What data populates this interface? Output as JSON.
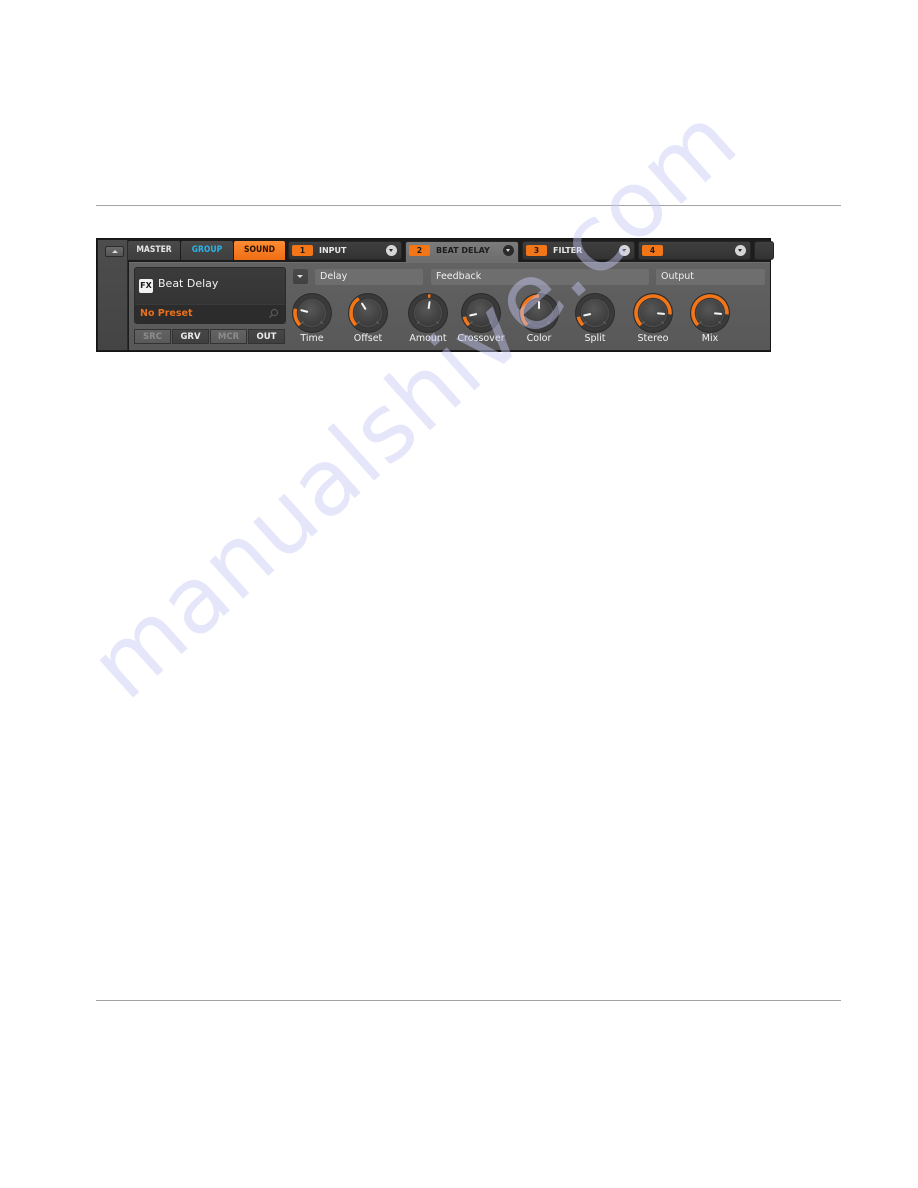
{
  "panel": {
    "collapse_icon": "triangle-up-icon",
    "tabs": [
      {
        "label": "MASTER",
        "state": "normal"
      },
      {
        "label": "GROUP",
        "state": "normal",
        "color": "#2bb3e6"
      },
      {
        "label": "SOUND",
        "state": "active",
        "color": "#f27518"
      }
    ],
    "slots": [
      {
        "number": "1",
        "name": "INPUT",
        "selected": false
      },
      {
        "number": "2",
        "name": "BEAT DELAY",
        "selected": true
      },
      {
        "number": "3",
        "name": "FILTER",
        "selected": false
      },
      {
        "number": "4",
        "name": "",
        "selected": false
      }
    ]
  },
  "preset": {
    "badge": "FX",
    "plugin_name": "Beat Delay",
    "preset_name": "No Preset",
    "search_icon": "magnifier-icon"
  },
  "pages": [
    {
      "label": "SRC",
      "enabled": false
    },
    {
      "label": "GRV",
      "enabled": true
    },
    {
      "label": "MCR",
      "enabled": false
    },
    {
      "label": "OUT",
      "enabled": true
    }
  ],
  "sections": [
    {
      "title": "Delay",
      "knobs": [
        {
          "label": "Time",
          "value": 0.22,
          "bipolar": false
        },
        {
          "label": "Offset",
          "value": 0.38,
          "bipolar": false
        }
      ]
    },
    {
      "title": "Feedback",
      "knobs": [
        {
          "label": "Amount",
          "value": 0.53,
          "bipolar": true
        },
        {
          "label": "Crossover",
          "value": 0.12,
          "bipolar": false
        },
        {
          "label": "Color",
          "value": 0.5,
          "bipolar": false
        },
        {
          "label": "Split",
          "value": 0.12,
          "bipolar": false
        }
      ]
    },
    {
      "title": "Output",
      "knobs": [
        {
          "label": "Stereo",
          "value": 0.85,
          "bipolar": false
        },
        {
          "label": "Mix",
          "value": 0.85,
          "bipolar": false
        }
      ]
    }
  ],
  "colors": {
    "accent": "#f27518",
    "group": "#2bb3e6",
    "panel_bg": "#5e5e5e"
  },
  "watermark": "manualshive.com"
}
